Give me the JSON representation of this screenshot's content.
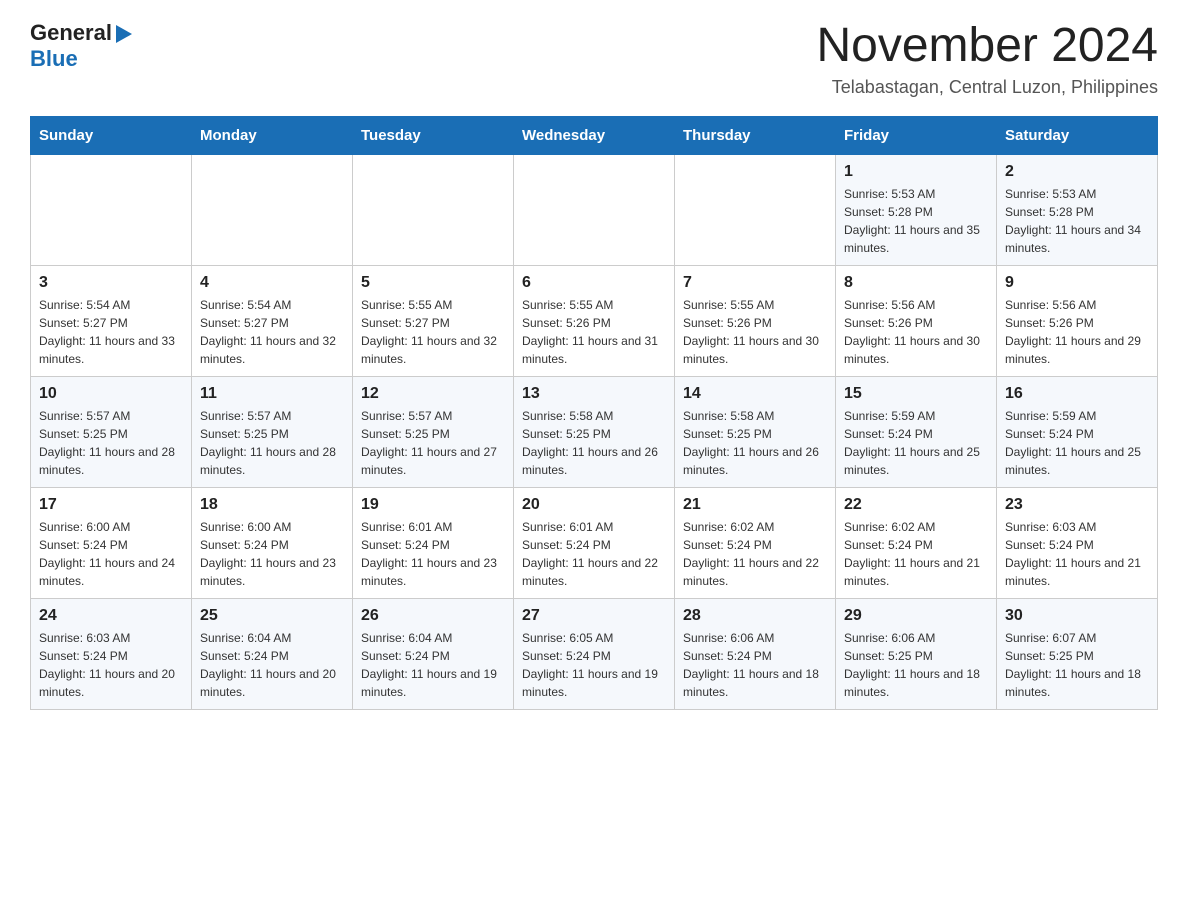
{
  "logo": {
    "text_general": "General",
    "triangle": "▶",
    "text_blue": "Blue"
  },
  "title": "November 2024",
  "location": "Telabastagan, Central Luzon, Philippines",
  "days_of_week": [
    "Sunday",
    "Monday",
    "Tuesday",
    "Wednesday",
    "Thursday",
    "Friday",
    "Saturday"
  ],
  "weeks": [
    [
      {
        "day": "",
        "detail": ""
      },
      {
        "day": "",
        "detail": ""
      },
      {
        "day": "",
        "detail": ""
      },
      {
        "day": "",
        "detail": ""
      },
      {
        "day": "",
        "detail": ""
      },
      {
        "day": "1",
        "detail": "Sunrise: 5:53 AM\nSunset: 5:28 PM\nDaylight: 11 hours and 35 minutes."
      },
      {
        "day": "2",
        "detail": "Sunrise: 5:53 AM\nSunset: 5:28 PM\nDaylight: 11 hours and 34 minutes."
      }
    ],
    [
      {
        "day": "3",
        "detail": "Sunrise: 5:54 AM\nSunset: 5:27 PM\nDaylight: 11 hours and 33 minutes."
      },
      {
        "day": "4",
        "detail": "Sunrise: 5:54 AM\nSunset: 5:27 PM\nDaylight: 11 hours and 32 minutes."
      },
      {
        "day": "5",
        "detail": "Sunrise: 5:55 AM\nSunset: 5:27 PM\nDaylight: 11 hours and 32 minutes."
      },
      {
        "day": "6",
        "detail": "Sunrise: 5:55 AM\nSunset: 5:26 PM\nDaylight: 11 hours and 31 minutes."
      },
      {
        "day": "7",
        "detail": "Sunrise: 5:55 AM\nSunset: 5:26 PM\nDaylight: 11 hours and 30 minutes."
      },
      {
        "day": "8",
        "detail": "Sunrise: 5:56 AM\nSunset: 5:26 PM\nDaylight: 11 hours and 30 minutes."
      },
      {
        "day": "9",
        "detail": "Sunrise: 5:56 AM\nSunset: 5:26 PM\nDaylight: 11 hours and 29 minutes."
      }
    ],
    [
      {
        "day": "10",
        "detail": "Sunrise: 5:57 AM\nSunset: 5:25 PM\nDaylight: 11 hours and 28 minutes."
      },
      {
        "day": "11",
        "detail": "Sunrise: 5:57 AM\nSunset: 5:25 PM\nDaylight: 11 hours and 28 minutes."
      },
      {
        "day": "12",
        "detail": "Sunrise: 5:57 AM\nSunset: 5:25 PM\nDaylight: 11 hours and 27 minutes."
      },
      {
        "day": "13",
        "detail": "Sunrise: 5:58 AM\nSunset: 5:25 PM\nDaylight: 11 hours and 26 minutes."
      },
      {
        "day": "14",
        "detail": "Sunrise: 5:58 AM\nSunset: 5:25 PM\nDaylight: 11 hours and 26 minutes."
      },
      {
        "day": "15",
        "detail": "Sunrise: 5:59 AM\nSunset: 5:24 PM\nDaylight: 11 hours and 25 minutes."
      },
      {
        "day": "16",
        "detail": "Sunrise: 5:59 AM\nSunset: 5:24 PM\nDaylight: 11 hours and 25 minutes."
      }
    ],
    [
      {
        "day": "17",
        "detail": "Sunrise: 6:00 AM\nSunset: 5:24 PM\nDaylight: 11 hours and 24 minutes."
      },
      {
        "day": "18",
        "detail": "Sunrise: 6:00 AM\nSunset: 5:24 PM\nDaylight: 11 hours and 23 minutes."
      },
      {
        "day": "19",
        "detail": "Sunrise: 6:01 AM\nSunset: 5:24 PM\nDaylight: 11 hours and 23 minutes."
      },
      {
        "day": "20",
        "detail": "Sunrise: 6:01 AM\nSunset: 5:24 PM\nDaylight: 11 hours and 22 minutes."
      },
      {
        "day": "21",
        "detail": "Sunrise: 6:02 AM\nSunset: 5:24 PM\nDaylight: 11 hours and 22 minutes."
      },
      {
        "day": "22",
        "detail": "Sunrise: 6:02 AM\nSunset: 5:24 PM\nDaylight: 11 hours and 21 minutes."
      },
      {
        "day": "23",
        "detail": "Sunrise: 6:03 AM\nSunset: 5:24 PM\nDaylight: 11 hours and 21 minutes."
      }
    ],
    [
      {
        "day": "24",
        "detail": "Sunrise: 6:03 AM\nSunset: 5:24 PM\nDaylight: 11 hours and 20 minutes."
      },
      {
        "day": "25",
        "detail": "Sunrise: 6:04 AM\nSunset: 5:24 PM\nDaylight: 11 hours and 20 minutes."
      },
      {
        "day": "26",
        "detail": "Sunrise: 6:04 AM\nSunset: 5:24 PM\nDaylight: 11 hours and 19 minutes."
      },
      {
        "day": "27",
        "detail": "Sunrise: 6:05 AM\nSunset: 5:24 PM\nDaylight: 11 hours and 19 minutes."
      },
      {
        "day": "28",
        "detail": "Sunrise: 6:06 AM\nSunset: 5:24 PM\nDaylight: 11 hours and 18 minutes."
      },
      {
        "day": "29",
        "detail": "Sunrise: 6:06 AM\nSunset: 5:25 PM\nDaylight: 11 hours and 18 minutes."
      },
      {
        "day": "30",
        "detail": "Sunrise: 6:07 AM\nSunset: 5:25 PM\nDaylight: 11 hours and 18 minutes."
      }
    ]
  ]
}
